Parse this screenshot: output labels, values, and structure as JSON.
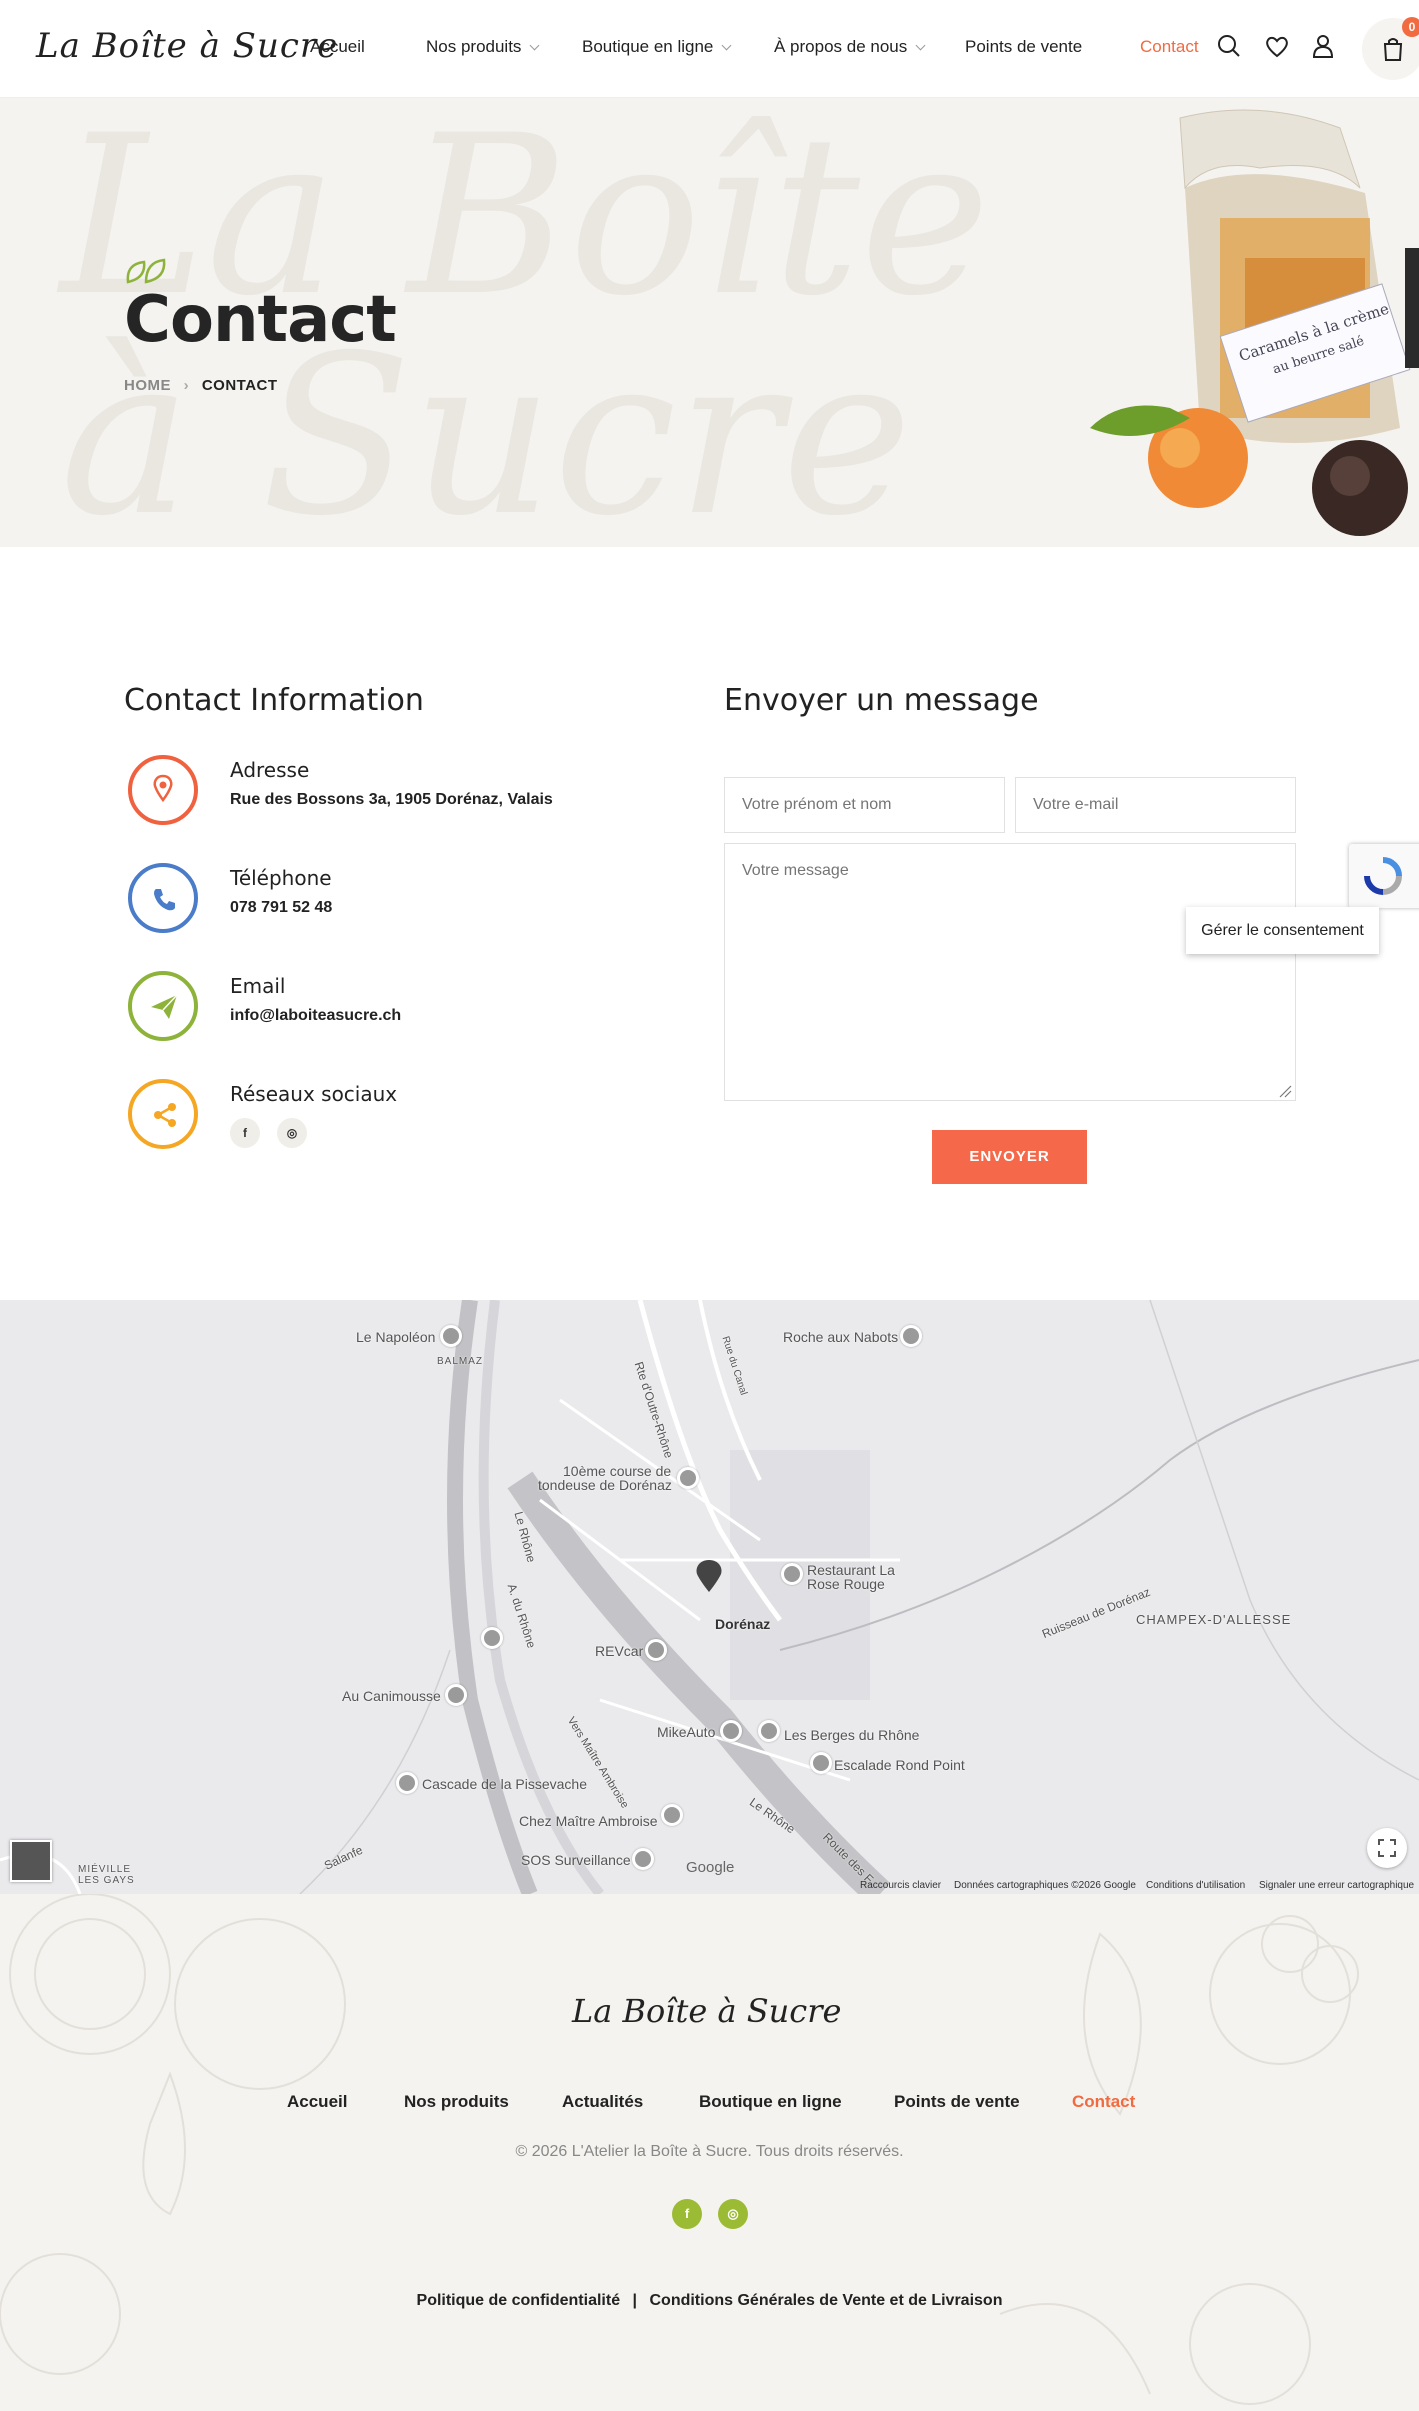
{
  "header": {
    "logo": "La Boîte à Sucre",
    "nav": [
      {
        "label": "Accueil"
      },
      {
        "label": "Nos produits"
      },
      {
        "label": "Boutique en ligne"
      },
      {
        "label": "À propos de nous"
      },
      {
        "label": "Points de vente"
      },
      {
        "label": "Contact"
      }
    ],
    "cart_count": "0",
    "accent": "#f16a40"
  },
  "hero": {
    "title": "Contact",
    "breadcrumb_home": "HOME",
    "breadcrumb_current": "CONTACT",
    "bg_text_1": "La Boîte",
    "bg_text_2": "à Sucre",
    "product_label_1": "Caramels à la crème",
    "product_label_2": "au beurre salé"
  },
  "contact_info": {
    "title": "Contact Information",
    "items": [
      {
        "title": "Adresse",
        "value": "Rue des Bossons 3a, 1905 Dorénaz, Valais",
        "icon": "location-icon",
        "color": "#f0613f"
      },
      {
        "title": "Téléphone",
        "value": "078 791 52 48",
        "icon": "phone-icon",
        "color": "#4a7cc9"
      },
      {
        "title": "Email",
        "value": "info@laboiteasucre.ch",
        "icon": "send-icon",
        "color": "#8db33a"
      },
      {
        "title": "Réseaux sociaux",
        "value": "",
        "icon": "share-icon",
        "color": "#f5a623"
      }
    ],
    "social": [
      "f",
      "◎"
    ]
  },
  "form": {
    "title": "Envoyer un message",
    "name_placeholder": "Votre prénom et nom",
    "email_placeholder": "Votre e-mail",
    "message_placeholder": "Votre message",
    "submit": "ENVOYER",
    "consent": "Gérer le consentement"
  },
  "map": {
    "labels": [
      "Le Napoléon",
      "BALMAZ",
      "Rte d'Outre-Rhône",
      "Rue du Canal",
      "Roche aux Nabots",
      "10ème course de",
      "tondeuse de Dorénaz",
      "Le Rhône",
      "A. du Rhône",
      "Restaurant La",
      "Rose Rouge",
      "Dorénaz",
      "REVcar",
      "Ruisseau de Dorénaz",
      "CHAMPEX-D'ALLESSE",
      "Au Canimousse",
      "MikeAuto",
      "Les Berges du Rhône",
      "Escalade Rond Point",
      "Cascade de la Pissevache",
      "Vers Maître Ambroise",
      "Chez Maître Ambroise",
      "Le Rhône",
      "Route des F",
      "Salanfe",
      "SOS Surveillance",
      "MIÉVILLE",
      "LES GAYS"
    ],
    "footer": [
      "Raccourcis clavier",
      "Données cartographiques ©2026 Google",
      "Conditions d'utilisation",
      "Signaler une erreur cartographique"
    ],
    "google": "Google"
  },
  "footer": {
    "logo": "La Boîte à Sucre",
    "links": [
      {
        "label": "Accueil"
      },
      {
        "label": "Nos produits"
      },
      {
        "label": "Actualités"
      },
      {
        "label": "Boutique en ligne"
      },
      {
        "label": "Points de vente"
      },
      {
        "label": "Contact"
      }
    ],
    "copyright": "© 2026 L'Atelier la Boîte à Sucre. Tous droits réservés.",
    "social": [
      "f",
      "◎"
    ],
    "legal_1": "Politique de confidentialité",
    "legal_sep": "|",
    "legal_2": "Conditions Générales de Vente et de Livraison"
  }
}
